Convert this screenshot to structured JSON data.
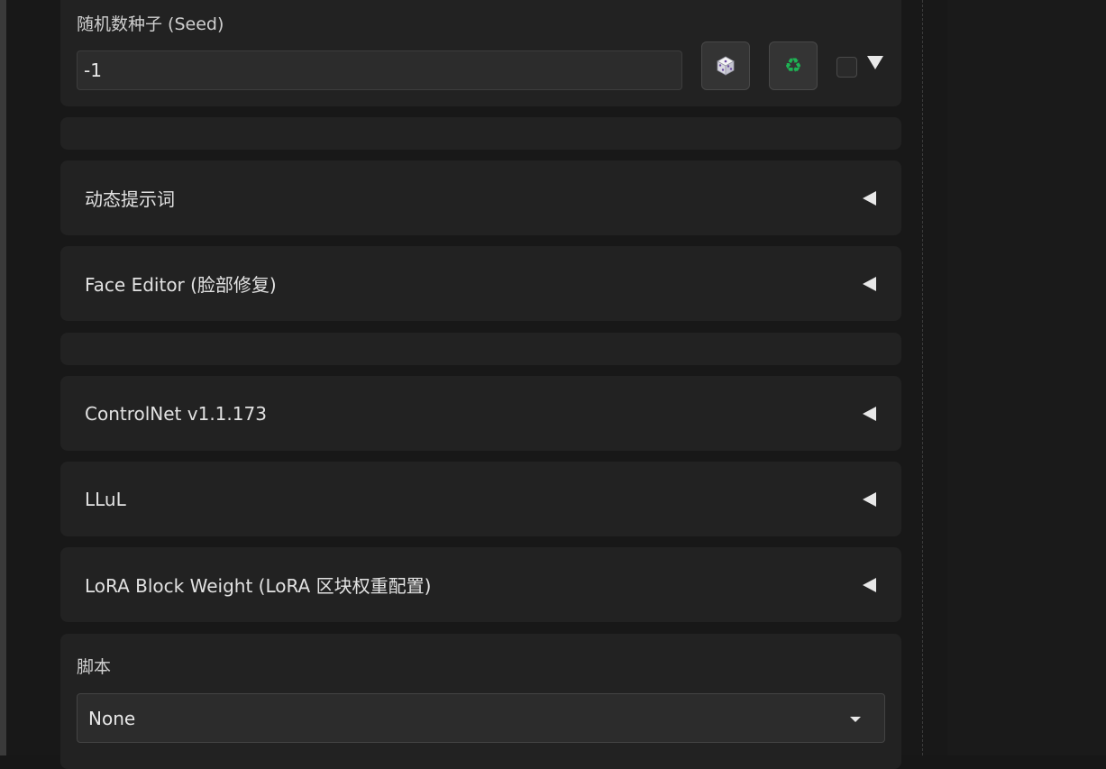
{
  "seed": {
    "label": "随机数种子 (Seed)",
    "value": "-1",
    "dice_button": "dice-icon",
    "recycle_button": "recycle-icon",
    "recycle_glyph": "♻",
    "extra_toggle": "triangle-down-icon"
  },
  "accordions": [
    {
      "title": "动态提示词"
    },
    {
      "title": "Face Editor (脸部修复)"
    },
    {
      "title": "ControlNet v1.1.173"
    },
    {
      "title": "LLuL"
    },
    {
      "title": "LoRA Block Weight (LoRA 区块权重配置)"
    }
  ],
  "script": {
    "label": "脚本",
    "selected": "None"
  },
  "colors": {
    "background": "#181818",
    "panel": "#222222",
    "input": "#2c2c2c",
    "recycle_accent": "#1eb354"
  }
}
